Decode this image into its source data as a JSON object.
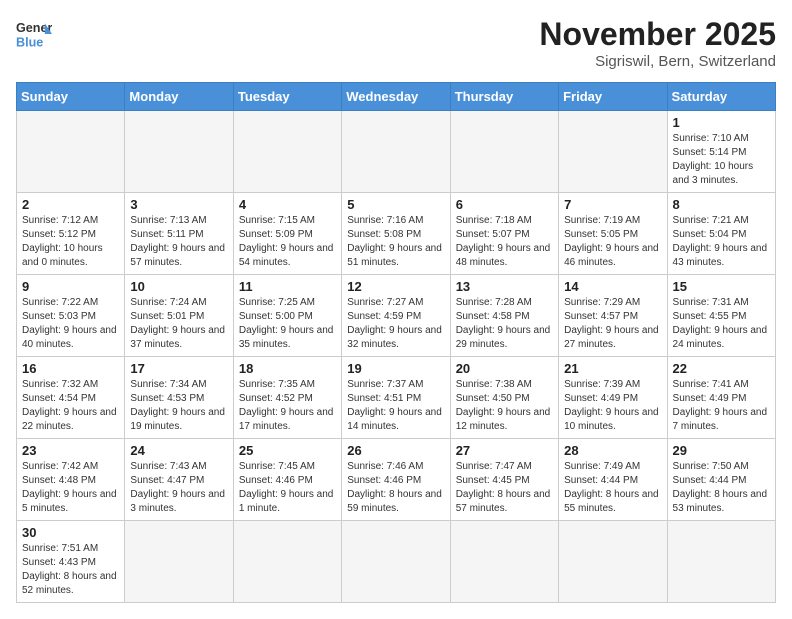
{
  "header": {
    "logo_general": "General",
    "logo_blue": "Blue",
    "month_title": "November 2025",
    "subtitle": "Sigriswil, Bern, Switzerland"
  },
  "days_of_week": [
    "Sunday",
    "Monday",
    "Tuesday",
    "Wednesday",
    "Thursday",
    "Friday",
    "Saturday"
  ],
  "weeks": [
    [
      {
        "day": "",
        "info": ""
      },
      {
        "day": "",
        "info": ""
      },
      {
        "day": "",
        "info": ""
      },
      {
        "day": "",
        "info": ""
      },
      {
        "day": "",
        "info": ""
      },
      {
        "day": "",
        "info": ""
      },
      {
        "day": "1",
        "info": "Sunrise: 7:10 AM\nSunset: 5:14 PM\nDaylight: 10 hours and 3 minutes."
      }
    ],
    [
      {
        "day": "2",
        "info": "Sunrise: 7:12 AM\nSunset: 5:12 PM\nDaylight: 10 hours and 0 minutes."
      },
      {
        "day": "3",
        "info": "Sunrise: 7:13 AM\nSunset: 5:11 PM\nDaylight: 9 hours and 57 minutes."
      },
      {
        "day": "4",
        "info": "Sunrise: 7:15 AM\nSunset: 5:09 PM\nDaylight: 9 hours and 54 minutes."
      },
      {
        "day": "5",
        "info": "Sunrise: 7:16 AM\nSunset: 5:08 PM\nDaylight: 9 hours and 51 minutes."
      },
      {
        "day": "6",
        "info": "Sunrise: 7:18 AM\nSunset: 5:07 PM\nDaylight: 9 hours and 48 minutes."
      },
      {
        "day": "7",
        "info": "Sunrise: 7:19 AM\nSunset: 5:05 PM\nDaylight: 9 hours and 46 minutes."
      },
      {
        "day": "8",
        "info": "Sunrise: 7:21 AM\nSunset: 5:04 PM\nDaylight: 9 hours and 43 minutes."
      }
    ],
    [
      {
        "day": "9",
        "info": "Sunrise: 7:22 AM\nSunset: 5:03 PM\nDaylight: 9 hours and 40 minutes."
      },
      {
        "day": "10",
        "info": "Sunrise: 7:24 AM\nSunset: 5:01 PM\nDaylight: 9 hours and 37 minutes."
      },
      {
        "day": "11",
        "info": "Sunrise: 7:25 AM\nSunset: 5:00 PM\nDaylight: 9 hours and 35 minutes."
      },
      {
        "day": "12",
        "info": "Sunrise: 7:27 AM\nSunset: 4:59 PM\nDaylight: 9 hours and 32 minutes."
      },
      {
        "day": "13",
        "info": "Sunrise: 7:28 AM\nSunset: 4:58 PM\nDaylight: 9 hours and 29 minutes."
      },
      {
        "day": "14",
        "info": "Sunrise: 7:29 AM\nSunset: 4:57 PM\nDaylight: 9 hours and 27 minutes."
      },
      {
        "day": "15",
        "info": "Sunrise: 7:31 AM\nSunset: 4:55 PM\nDaylight: 9 hours and 24 minutes."
      }
    ],
    [
      {
        "day": "16",
        "info": "Sunrise: 7:32 AM\nSunset: 4:54 PM\nDaylight: 9 hours and 22 minutes."
      },
      {
        "day": "17",
        "info": "Sunrise: 7:34 AM\nSunset: 4:53 PM\nDaylight: 9 hours and 19 minutes."
      },
      {
        "day": "18",
        "info": "Sunrise: 7:35 AM\nSunset: 4:52 PM\nDaylight: 9 hours and 17 minutes."
      },
      {
        "day": "19",
        "info": "Sunrise: 7:37 AM\nSunset: 4:51 PM\nDaylight: 9 hours and 14 minutes."
      },
      {
        "day": "20",
        "info": "Sunrise: 7:38 AM\nSunset: 4:50 PM\nDaylight: 9 hours and 12 minutes."
      },
      {
        "day": "21",
        "info": "Sunrise: 7:39 AM\nSunset: 4:49 PM\nDaylight: 9 hours and 10 minutes."
      },
      {
        "day": "22",
        "info": "Sunrise: 7:41 AM\nSunset: 4:49 PM\nDaylight: 9 hours and 7 minutes."
      }
    ],
    [
      {
        "day": "23",
        "info": "Sunrise: 7:42 AM\nSunset: 4:48 PM\nDaylight: 9 hours and 5 minutes."
      },
      {
        "day": "24",
        "info": "Sunrise: 7:43 AM\nSunset: 4:47 PM\nDaylight: 9 hours and 3 minutes."
      },
      {
        "day": "25",
        "info": "Sunrise: 7:45 AM\nSunset: 4:46 PM\nDaylight: 9 hours and 1 minute."
      },
      {
        "day": "26",
        "info": "Sunrise: 7:46 AM\nSunset: 4:46 PM\nDaylight: 8 hours and 59 minutes."
      },
      {
        "day": "27",
        "info": "Sunrise: 7:47 AM\nSunset: 4:45 PM\nDaylight: 8 hours and 57 minutes."
      },
      {
        "day": "28",
        "info": "Sunrise: 7:49 AM\nSunset: 4:44 PM\nDaylight: 8 hours and 55 minutes."
      },
      {
        "day": "29",
        "info": "Sunrise: 7:50 AM\nSunset: 4:44 PM\nDaylight: 8 hours and 53 minutes."
      }
    ],
    [
      {
        "day": "30",
        "info": "Sunrise: 7:51 AM\nSunset: 4:43 PM\nDaylight: 8 hours and 52 minutes."
      },
      {
        "day": "",
        "info": ""
      },
      {
        "day": "",
        "info": ""
      },
      {
        "day": "",
        "info": ""
      },
      {
        "day": "",
        "info": ""
      },
      {
        "day": "",
        "info": ""
      },
      {
        "day": "",
        "info": ""
      }
    ]
  ]
}
